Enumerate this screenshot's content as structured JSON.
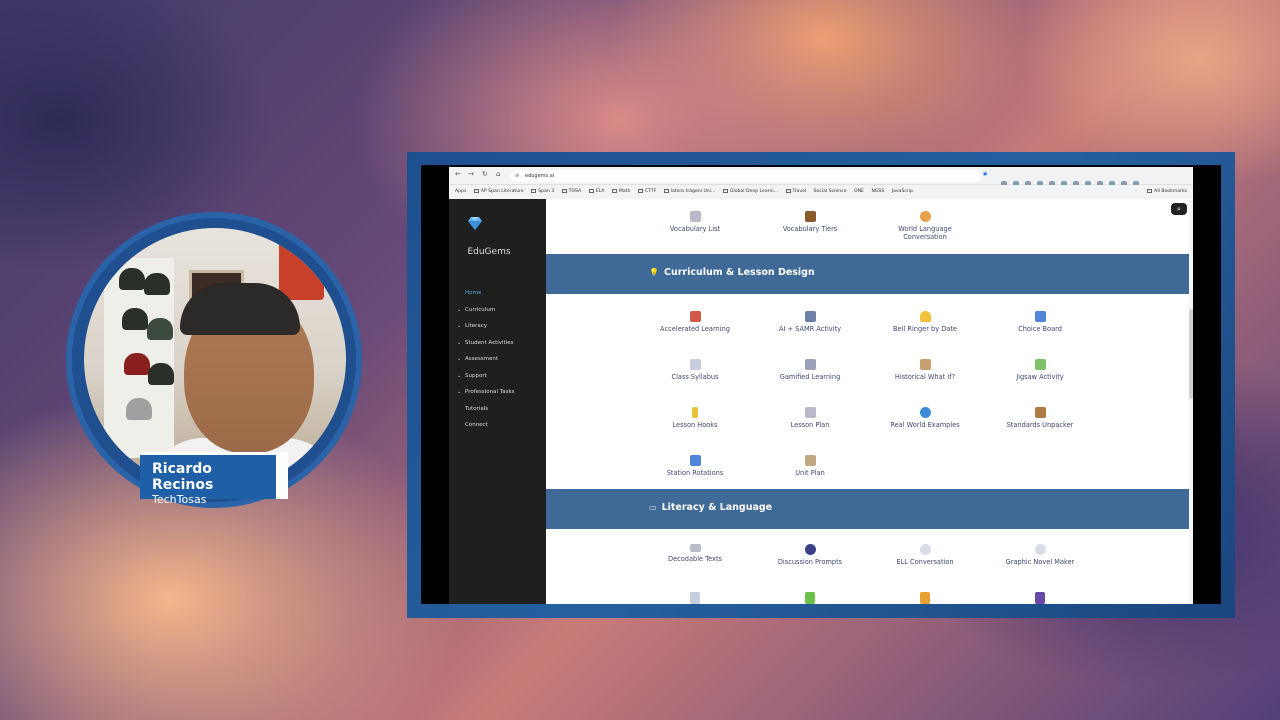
{
  "presenter": {
    "name": "Ricardo Recinos",
    "org": "TechTosas"
  },
  "browser": {
    "url": "edugems.ai",
    "bookmarks": [
      "Apps",
      "AP Span Literature",
      "Span 3",
      "TOSA",
      "ELA",
      "Math",
      "CTTF",
      "latera tragoni Uni...",
      "Global Deep Learni...",
      "Travel",
      "Social Science",
      "ONE",
      "NGSS",
      "JavaScrip"
    ],
    "all_bookmarks": "All Bookmarks"
  },
  "site": {
    "brand": "EduGems",
    "menu": [
      {
        "label": "Home",
        "expandable": false,
        "active": true
      },
      {
        "label": "Curriculum",
        "expandable": true,
        "active": false
      },
      {
        "label": "Literacy",
        "expandable": true,
        "active": false
      },
      {
        "label": "Student Activities",
        "expandable": true,
        "active": false
      },
      {
        "label": "Assessment",
        "expandable": true,
        "active": false
      },
      {
        "label": "Support",
        "expandable": true,
        "active": false
      },
      {
        "label": "Professional Tasks",
        "expandable": true,
        "active": false
      },
      {
        "label": "Tutorials",
        "expandable": false,
        "active": false
      },
      {
        "label": "Connect",
        "expandable": false,
        "active": false
      }
    ],
    "top_tiles": [
      {
        "label": "Vocabulary List",
        "icon": "clipboard-icon",
        "color": "#b9b9c9"
      },
      {
        "label": "Vocabulary Tiers",
        "icon": "ladder-icon",
        "color": "#8a5a2b"
      },
      {
        "label": "World Language Conversation",
        "icon": "globe-icon",
        "color": "#e9a04a"
      }
    ],
    "curriculum_section": {
      "title": "Curriculum & Lesson Design",
      "icon": "lightbulb-icon",
      "tiles": [
        {
          "label": "Accelerated Learning",
          "icon": "rocket-icon",
          "color": "#d2584a"
        },
        {
          "label": "AI + SAMR Activity",
          "icon": "robot-icon",
          "color": "#6d7fa8"
        },
        {
          "label": "Bell Ringer by Date",
          "icon": "bell-icon",
          "color": "#f2c13b"
        },
        {
          "label": "Choice Board",
          "icon": "grid-icon",
          "color": "#4f86d8"
        },
        {
          "label": "Class Syllabus",
          "icon": "page-icon",
          "color": "#c8cde0"
        },
        {
          "label": "Gamified Learning",
          "icon": "dice-icon",
          "color": "#9aa0b8"
        },
        {
          "label": "Historical What If?",
          "icon": "hourglass-icon",
          "color": "#c8a070"
        },
        {
          "label": "Jigsaw Activity",
          "icon": "puzzle-icon",
          "color": "#7cc26a"
        },
        {
          "label": "Lesson Hooks",
          "icon": "hook-icon",
          "color": "#e8c23a"
        },
        {
          "label": "Lesson Plan",
          "icon": "clipboard-icon",
          "color": "#b9b9c9"
        },
        {
          "label": "Real World Examples",
          "icon": "globe-icon",
          "color": "#3b8bd6"
        },
        {
          "label": "Standards Unpacker",
          "icon": "box-icon",
          "color": "#b07a45"
        },
        {
          "label": "Station Rotations",
          "icon": "cycle-icon",
          "color": "#4f86d8"
        },
        {
          "label": "Unit Plan",
          "icon": "clipboard-icon",
          "color": "#c0a884"
        }
      ]
    },
    "literacy_section": {
      "title": "Literacy & Language",
      "icon": "book-icon",
      "tiles": [
        {
          "label": "Decodable Texts",
          "icon": "book-icon",
          "color": "#b8bccc"
        },
        {
          "label": "Discussion Prompts",
          "icon": "speaker-head-icon",
          "color": "#3b3f8a"
        },
        {
          "label": "ELL Conversation",
          "icon": "speech-bubble-icon",
          "color": "#d8dce6"
        },
        {
          "label": "Graphic Novel Maker",
          "icon": "thought-bubble-icon",
          "color": "#d8dce6"
        }
      ],
      "partial_icons": [
        {
          "icon": "page-icon",
          "color": "#c8cde0"
        },
        {
          "icon": "green-book-icon",
          "color": "#6fbf4a"
        },
        {
          "icon": "pencil-icon",
          "color": "#e8a030"
        },
        {
          "icon": "music-note-icon",
          "color": "#6a4aa8"
        }
      ]
    }
  }
}
